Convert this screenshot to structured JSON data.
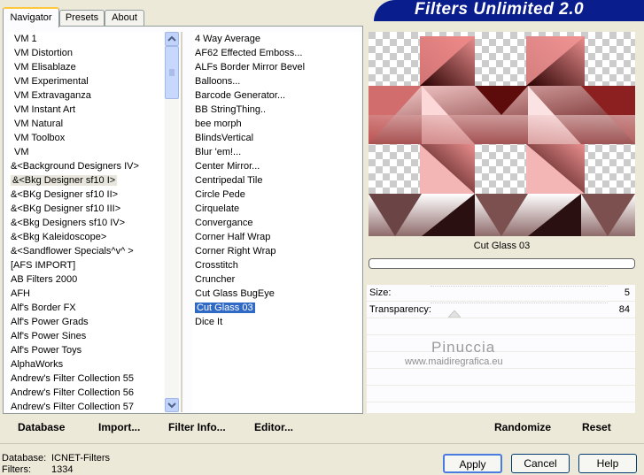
{
  "tabs": [
    {
      "label": "Navigator",
      "active": true
    },
    {
      "label": "Presets",
      "active": false
    },
    {
      "label": "About",
      "active": false
    }
  ],
  "banner": {
    "title": "Filters Unlimited 2.0"
  },
  "categories": [
    "VM 1",
    "VM Distortion",
    "VM Elisablaze",
    "VM Experimental",
    "VM Extravaganza",
    "VM Instant Art",
    "VM Natural",
    "VM Toolbox",
    "VM",
    "&<Background Designers IV>",
    "&<Bkg Designer sf10 I>",
    "&<BKg Designer sf10 II>",
    "&<BKg Designer sf10 III>",
    "&<Bkg Designers sf10 IV>",
    "&<Bkg Kaleidoscope>",
    "&<Sandflower Specials^v^ >",
    "[AFS IMPORT]",
    "AB Filters 2000",
    "AFH",
    "Alf's Border FX",
    "Alf's Power Grads",
    "Alf's Power Sines",
    "Alf's Power Toys",
    "AlphaWorks",
    "Andrew's Filter Collection 55",
    "Andrew's Filter Collection 56",
    "Andrew's Filter Collection 57"
  ],
  "selected_category": "&<Bkg Designer sf10 I>",
  "filters": [
    "4 Way Average",
    "AF62 Effected Emboss...",
    "ALFs Border Mirror Bevel",
    "Balloons...",
    "Barcode Generator...",
    "BB StringThing..",
    "bee morph",
    "BlindsVertical",
    "Blur 'em!...",
    "Center Mirror...",
    "Centripedal Tile",
    "Circle Pede",
    "Cirquelate",
    "Convergance",
    "Corner Half Wrap",
    "Corner Right Wrap",
    "Crosstitch",
    "Cruncher",
    "Cut Glass  BugEye",
    "Cut Glass 03",
    "Dice It"
  ],
  "selected_filter": "Cut Glass 03",
  "bottom_links": {
    "database": "Database",
    "import": "Import...",
    "filter_info": "Filter Info...",
    "editor": "Editor...",
    "randomize": "Randomize",
    "reset": "Reset"
  },
  "preview": {
    "filter_name": "Cut Glass 03"
  },
  "params": [
    {
      "label": "Size:",
      "value": "5"
    },
    {
      "label": "Transparency:",
      "value": "84"
    }
  ],
  "watermark": {
    "name": "Pinuccia",
    "url": "www.maidiregrafica.eu"
  },
  "status": {
    "database_label": "Database:",
    "database_value": "ICNET-Filters",
    "filters_label": "Filters:",
    "filters_value": "1334"
  },
  "buttons": {
    "apply": "Apply",
    "cancel": "Cancel",
    "help": "Help"
  },
  "colors": {
    "banner": "#0a1d8c",
    "selection": "#316ac5",
    "tab_highlight": "#ffc83c"
  }
}
